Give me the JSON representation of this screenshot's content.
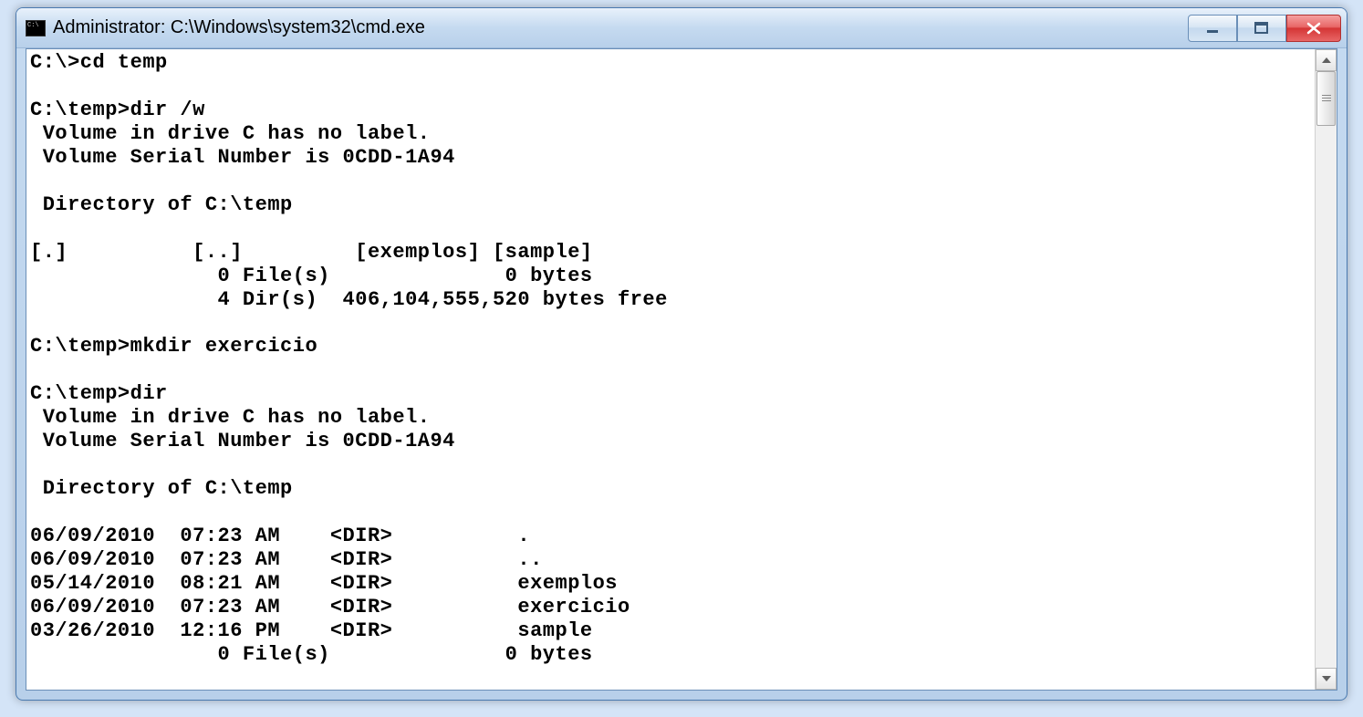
{
  "window": {
    "title": "Administrator: C:\\Windows\\system32\\cmd.exe"
  },
  "terminal": {
    "lines": [
      "C:\\>cd temp",
      "",
      "C:\\temp>dir /w",
      " Volume in drive C has no label.",
      " Volume Serial Number is 0CDD-1A94",
      "",
      " Directory of C:\\temp",
      "",
      "[.]          [..]         [exemplos] [sample]",
      "               0 File(s)              0 bytes",
      "               4 Dir(s)  406,104,555,520 bytes free",
      "",
      "C:\\temp>mkdir exercicio",
      "",
      "C:\\temp>dir",
      " Volume in drive C has no label.",
      " Volume Serial Number is 0CDD-1A94",
      "",
      " Directory of C:\\temp",
      "",
      "06/09/2010  07:23 AM    <DIR>          .",
      "06/09/2010  07:23 AM    <DIR>          ..",
      "05/14/2010  08:21 AM    <DIR>          exemplos",
      "06/09/2010  07:23 AM    <DIR>          exercicio",
      "03/26/2010  12:16 PM    <DIR>          sample",
      "               0 File(s)              0 bytes"
    ]
  }
}
